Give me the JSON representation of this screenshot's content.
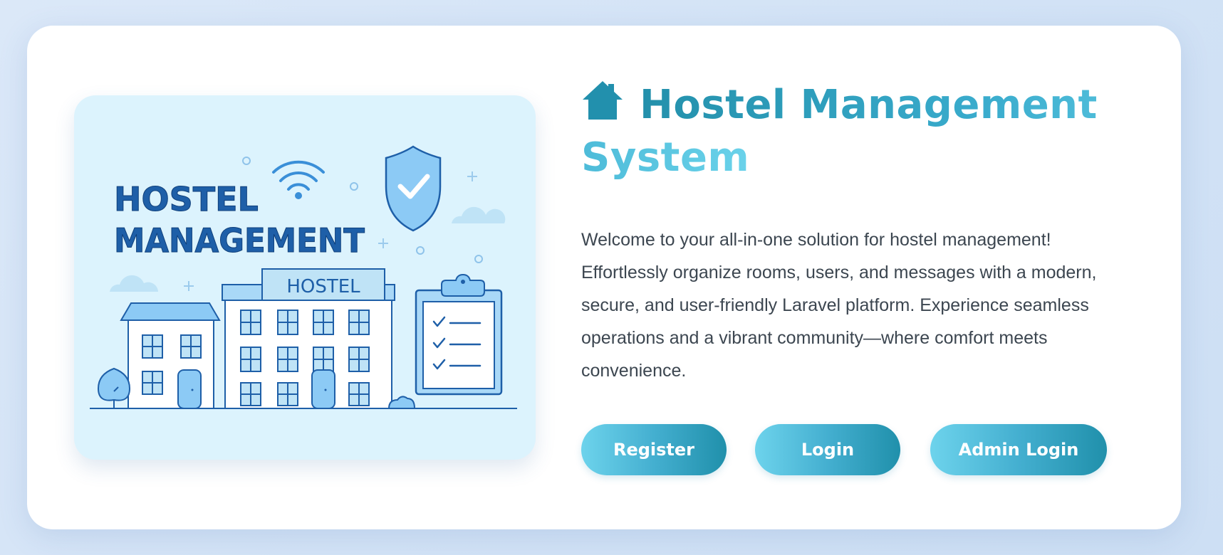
{
  "hero": {
    "title": "Hostel Management System",
    "description": "Welcome to your all-in-one solution for hostel management! Effortlessly organize rooms, users, and messages with a modern, secure, and user-friendly Laravel platform. Experience seamless operations and a vibrant community—where comfort meets convenience."
  },
  "illustration": {
    "heading_line1": "HOSTEL",
    "heading_line2": "MANAGEMENT",
    "sign": "HOSTEL"
  },
  "actions": {
    "register": "Register",
    "login": "Login",
    "admin_login": "Admin Login"
  },
  "colors": {
    "accent": "#2a98b6",
    "accent_light": "#6dd3ec",
    "illustration_bg": "#dcf3fd",
    "illustration_blue": "#1e5fa8"
  },
  "icons": {
    "title": "home-icon",
    "illustration": [
      "wifi-icon",
      "shield-check-icon",
      "clipboard-checklist-icon",
      "cloud-icon",
      "tree-icon"
    ]
  }
}
